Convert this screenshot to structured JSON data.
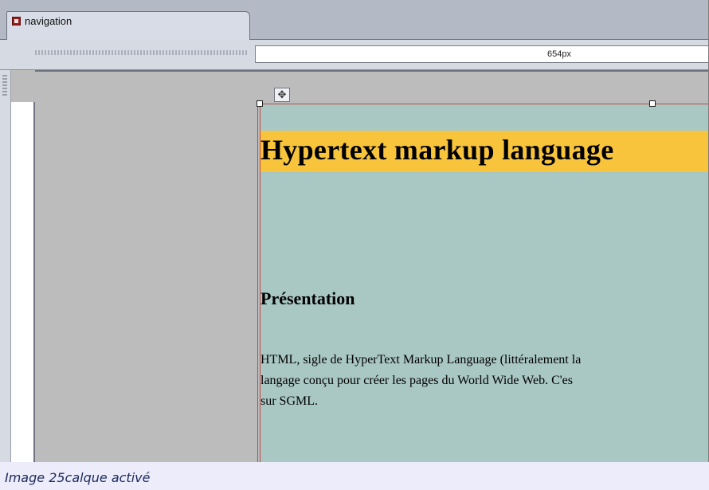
{
  "tab": {
    "label": "navigation",
    "icon": "document-icon"
  },
  "ruler": {
    "width_value": "654px"
  },
  "layer": {
    "move_icon": "move-icon",
    "heading": "Hypertext markup language",
    "subheading": "Présentation",
    "paragraph_lines": [
      "HTML, sigle de HyperText Markup Language (littéralement la",
      "langage conçu pour créer les pages du World Wide Web. C'es",
      "sur SGML."
    ]
  },
  "caption": "Image 25calque activé",
  "colors": {
    "heading_highlight": "#f7c43c",
    "layer_background": "#a9c7c3",
    "selection_border": "#c24a4a",
    "canvas_gray": "#bcbcbc"
  }
}
